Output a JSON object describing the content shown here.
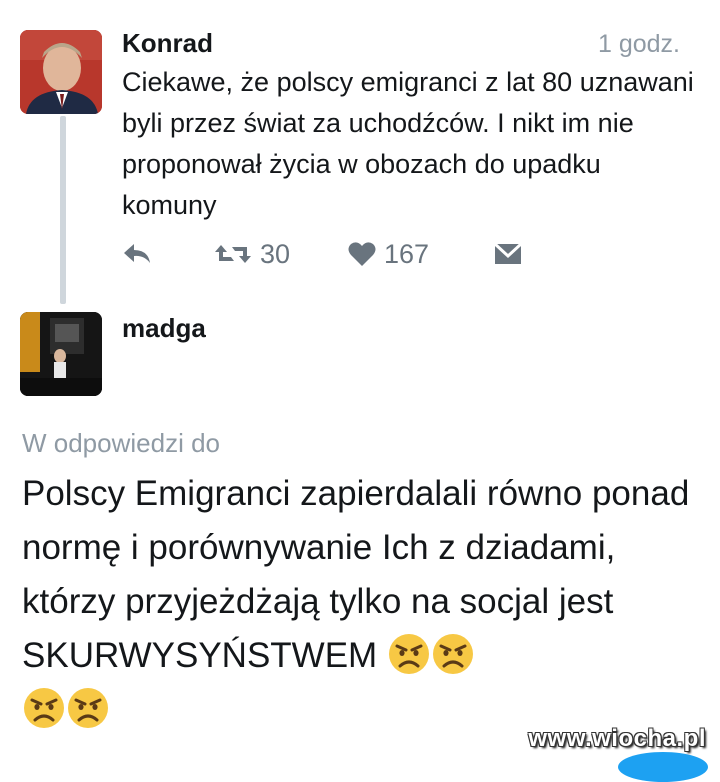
{
  "tweet": {
    "author": "Konrad",
    "time": "1 godz.",
    "text": "Ciekawe, że polscy emigranci z lat 80 uznawani byli przez świat za uchodźców. I nikt im nie proponował życia w obozach do upadku komuny",
    "actions": {
      "reply_icon": "reply-arrow-icon",
      "retweet_icon": "retweet-icon",
      "retweet_count": "30",
      "like_icon": "heart-icon",
      "like_count": "167",
      "dm_icon": "envelope-icon"
    }
  },
  "reply": {
    "author": "madga",
    "in_reply_to_label": "W odpowiedzi do",
    "text": "Polscy Emigranci zapierdalali równo ponad normę i porównywanie Ich z dziadami, którzy przyjeżdżają tylko na socjal jest SKURWYSYŃSTWEM",
    "emoji": "angry-face-icon",
    "emoji_count": 4
  },
  "watermark": "www.wiocha.pl",
  "colors": {
    "text": "#14171a",
    "muted": "#8f9aa4",
    "icon": "#69747e",
    "thread_line": "#cfd6dc"
  }
}
